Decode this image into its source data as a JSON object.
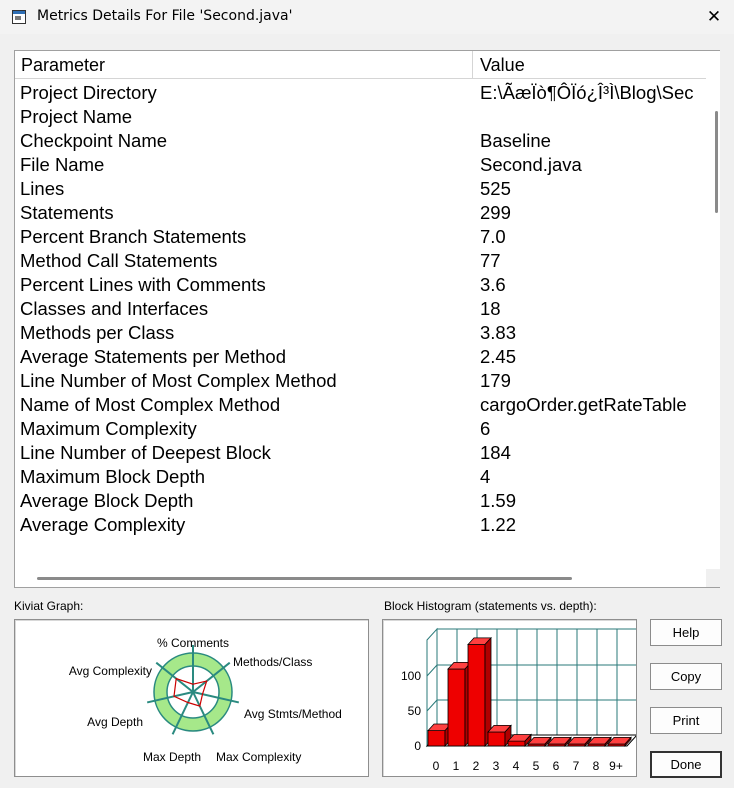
{
  "window": {
    "title": "Metrics Details For File 'Second.java'",
    "close_glyph": "✕"
  },
  "table": {
    "columns": [
      "Parameter",
      "Value"
    ],
    "rows": [
      {
        "parameter": "Project Directory",
        "value": "E:\\ÃæÏò¶ÔÏó¿Î³Ì\\Blog\\Sec"
      },
      {
        "parameter": "Project Name",
        "value": ""
      },
      {
        "parameter": "Checkpoint Name",
        "value": "Baseline"
      },
      {
        "parameter": "File Name",
        "value": "Second.java"
      },
      {
        "parameter": "Lines",
        "value": "525"
      },
      {
        "parameter": "Statements",
        "value": "299"
      },
      {
        "parameter": "Percent Branch Statements",
        "value": "7.0"
      },
      {
        "parameter": "Method Call Statements",
        "value": "77"
      },
      {
        "parameter": "Percent Lines with Comments",
        "value": "3.6"
      },
      {
        "parameter": "Classes and Interfaces",
        "value": "18"
      },
      {
        "parameter": "Methods per Class",
        "value": "3.83"
      },
      {
        "parameter": "Average Statements per Method",
        "value": "2.45"
      },
      {
        "parameter": "Line Number of Most Complex Method",
        "value": "179"
      },
      {
        "parameter": "Name of Most Complex Method",
        "value": "cargoOrder.getRateTable"
      },
      {
        "parameter": "Maximum Complexity",
        "value": "6"
      },
      {
        "parameter": "Line Number of Deepest Block",
        "value": "184"
      },
      {
        "parameter": "Maximum Block Depth",
        "value": "4"
      },
      {
        "parameter": "Average Block Depth",
        "value": "1.59"
      },
      {
        "parameter": "Average Complexity",
        "value": "1.22"
      }
    ]
  },
  "kiviat": {
    "label": "Kiviat Graph:",
    "axes": [
      "% Comments",
      "Methods/Class",
      "Avg Stmts/Method",
      "Max Complexity",
      "Max Depth",
      "Avg Depth",
      "Avg Complexity"
    ],
    "values": [
      0.2,
      0.45,
      0.25,
      0.4,
      0.3,
      0.5,
      0.55
    ],
    "colors": {
      "ring": "#a6e88a",
      "inner": "#ffffff",
      "spoke": "#2a8a80",
      "polygon": "#cc0000"
    }
  },
  "histogram": {
    "label": "Block Histogram (statements vs. depth):",
    "bar_color": "#ee0000"
  },
  "chart_data": {
    "type": "bar",
    "title": "Block Histogram (statements vs. depth):",
    "categories": [
      "0",
      "1",
      "2",
      "3",
      "4",
      "5",
      "6",
      "7",
      "8",
      "9+"
    ],
    "values": [
      22,
      110,
      145,
      20,
      7,
      2,
      2,
      2,
      1,
      1
    ],
    "yticks": [
      "0",
      "50",
      "100"
    ],
    "ylim": [
      0,
      150
    ],
    "grid": true
  },
  "buttons": {
    "help": "Help",
    "copy": "Copy",
    "print": "Print",
    "done": "Done"
  }
}
